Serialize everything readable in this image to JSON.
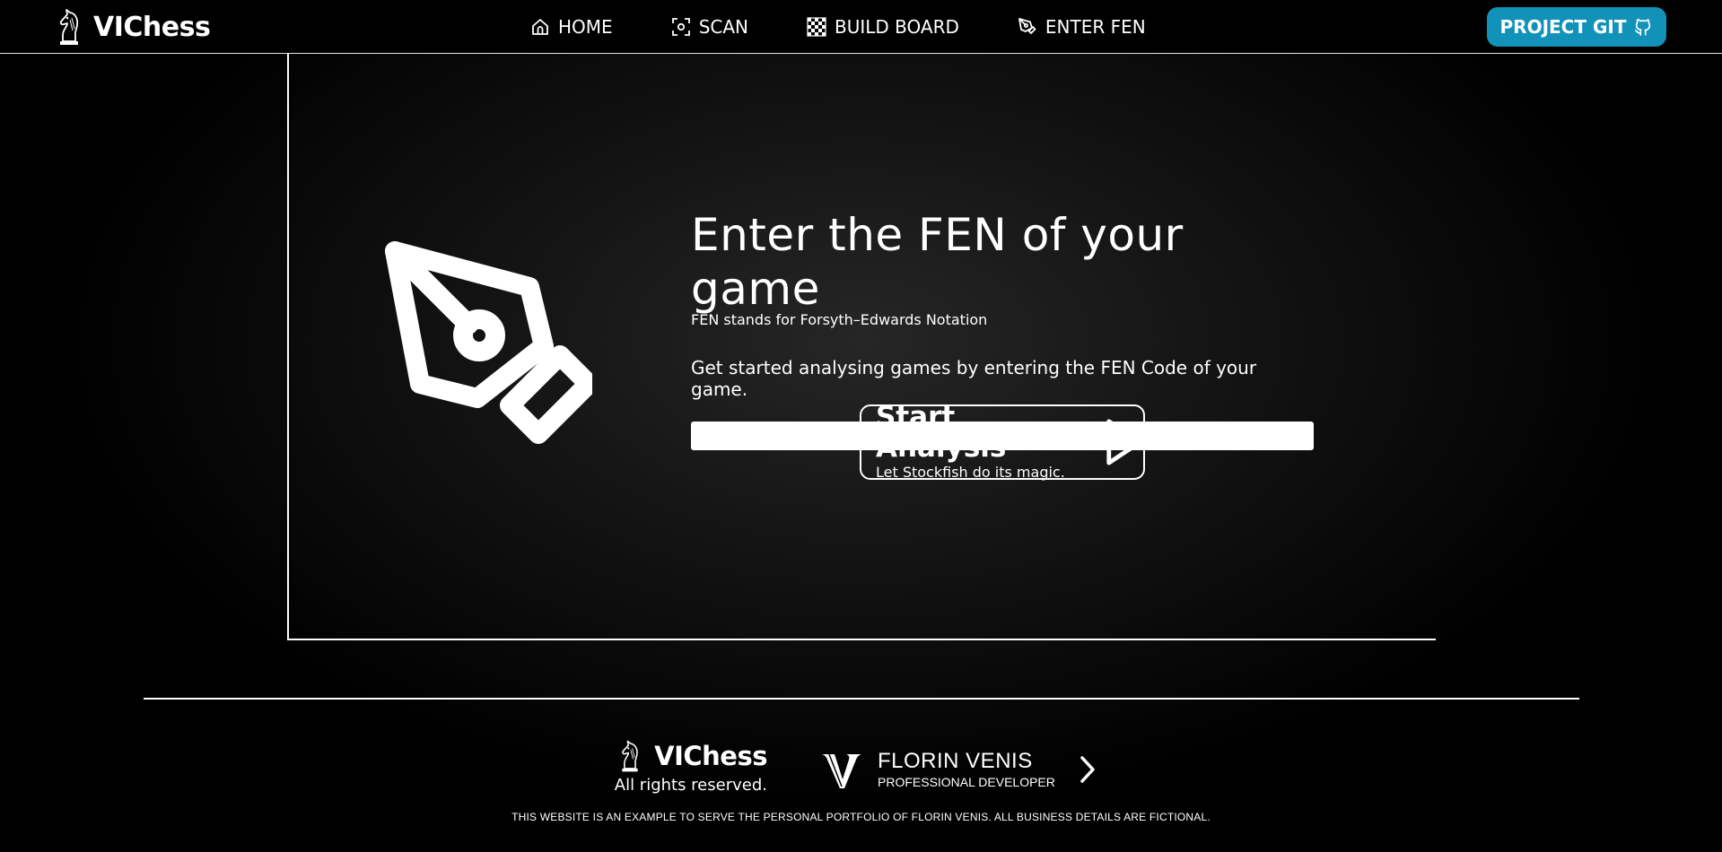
{
  "brand": {
    "name": "VIChess"
  },
  "nav": {
    "home": "HOME",
    "scan": "SCAN",
    "build_board": "BUILD BOARD",
    "enter_fen": "ENTER FEN"
  },
  "git_button": {
    "label": "PROJECT GIT",
    "color": "#1292b8"
  },
  "main": {
    "title": "Enter the FEN of your game",
    "subtitle": "FEN stands for Forsyth–Edwards Notation",
    "lead": "Get started analysing games by entering the FEN Code of your game.",
    "fen_value": "",
    "start": {
      "title": "Start Analysis",
      "subtitle": "Let Stockfish do its magic."
    }
  },
  "footer": {
    "brand_name": "VIChess",
    "rights": "All rights reserved.",
    "developer_name": "FLORIN VENIS",
    "developer_role": "PROFESSIONAL DEVELOPER",
    "disclaimer": "THIS WEBSITE IS AN EXAMPLE TO SERVE THE PERSONAL PORTFOLIO OF FLORIN VENIS. ALL BUSINESS DETAILS ARE FICTIONAL."
  },
  "icons": {
    "brand_logo": "chess-knight-icon",
    "home": "home-icon",
    "scan": "scan-icon",
    "build_board": "checkerboard-icon",
    "enter_fen": "pen-nib-icon",
    "git": "github-icon",
    "hero": "pen-nib-icon",
    "start": "play-icon",
    "developer_logo": "v-monogram-icon",
    "developer_link": "chevron-right-icon"
  }
}
